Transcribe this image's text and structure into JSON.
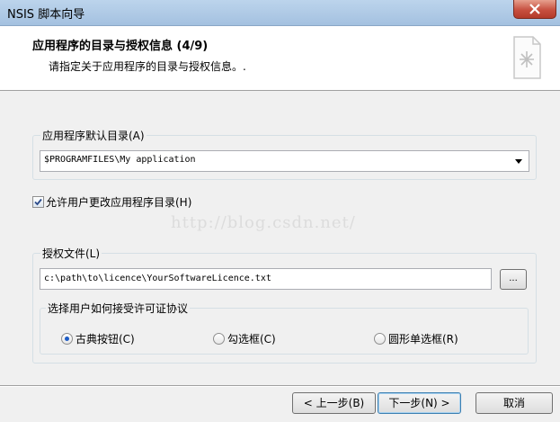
{
  "window": {
    "title": "NSIS 脚本向导"
  },
  "header": {
    "title": "应用程序的目录与授权信息 (4/9)",
    "subtitle": "请指定关于应用程序的目录与授权信息。."
  },
  "install_dir": {
    "group_label": "应用程序默认目录(A)",
    "value": "$PROGRAMFILES\\My application"
  },
  "allow_change": {
    "label": "允许用户更改应用程序目录(H)",
    "checked": true
  },
  "watermark": "http://blog.csdn.net/",
  "license": {
    "group_label": "授权文件(L)",
    "path": "c:\\path\\to\\licence\\YourSoftwareLicence.txt",
    "browse_label": "...",
    "accept_group_label": "选择用户如何接受许可证协议",
    "options": [
      {
        "label": "古典按钮(C)",
        "selected": true
      },
      {
        "label": "勾选框(C)",
        "selected": false
      },
      {
        "label": "圆形单选框(R)",
        "selected": false
      }
    ]
  },
  "buttons": {
    "back": "< 上一步(B)",
    "next": "下一步(N) >",
    "cancel": "取消"
  }
}
